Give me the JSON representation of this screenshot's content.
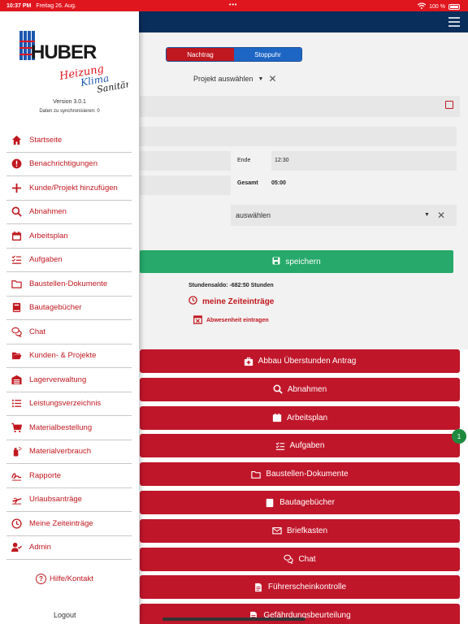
{
  "status": {
    "time": "10:37 PM",
    "date": "Freitag 26. Aug.",
    "battery": "100 %"
  },
  "segment": {
    "left": "Nachtrag",
    "right": "Stoppuhr"
  },
  "project_select": {
    "placeholder": "Projekt auswählen"
  },
  "form": {
    "ende_label": "Ende",
    "ende_value": "12:30",
    "gesamt_label": "Gesamt",
    "gesamt_value": "05:00",
    "select_placeholder": "auswählen",
    "save_label": "speichern",
    "saldo": "Stundensaldo: -682:50 Stunden",
    "zeiteintraege": "meine Zeiteinträge",
    "abwesenheit": "Abwesenheit eintragen"
  },
  "buttons": [
    {
      "label": "Abbau Überstunden Antrag",
      "icon": "first-aid-icon"
    },
    {
      "label": "Abnahmen",
      "icon": "search-icon"
    },
    {
      "label": "Arbeitsplan",
      "icon": "calendar-icon"
    },
    {
      "label": "Aufgaben",
      "icon": "checklist-icon"
    },
    {
      "label": "Baustellen-Dokumente",
      "icon": "folder-icon"
    },
    {
      "label": "Bautagebücher",
      "icon": "book-icon"
    },
    {
      "label": "Briefkasten",
      "icon": "mail-icon"
    },
    {
      "label": "Chat",
      "icon": "chat-icon"
    },
    {
      "label": "Führerscheinkontrolle",
      "icon": "document-icon"
    },
    {
      "label": "Gefährdungsbeurteilung",
      "icon": "document-icon"
    }
  ],
  "badge": "1",
  "drawer": {
    "logo": {
      "main": "HUBER",
      "line1": "Heizung",
      "line2": "Klima",
      "line3": "Sanitär"
    },
    "version": "Version 3.0.1",
    "sync": "Daten zu synchronisieren: 0",
    "items": [
      {
        "label": "Startseite",
        "icon": "home-icon"
      },
      {
        "label": "Benachrichtigungen",
        "icon": "alert-icon"
      },
      {
        "label": "Kunde/Projekt hinzufügen",
        "icon": "plus-icon"
      },
      {
        "label": "Abnahmen",
        "icon": "search-icon"
      },
      {
        "label": "Arbeitsplan",
        "icon": "calendar-icon"
      },
      {
        "label": "Aufgaben",
        "icon": "checklist-icon"
      },
      {
        "label": "Baustellen-Dokumente",
        "icon": "folder-icon"
      },
      {
        "label": "Bautagebücher",
        "icon": "book-icon"
      },
      {
        "label": "Chat",
        "icon": "chat-icon"
      },
      {
        "label": "Kunden- & Projekte",
        "icon": "folder-open-icon"
      },
      {
        "label": "Lagerverwaltung",
        "icon": "warehouse-icon"
      },
      {
        "label": "Leistungsverzeichnis",
        "icon": "list-icon"
      },
      {
        "label": "Materialbestellung",
        "icon": "cart-icon"
      },
      {
        "label": "Materialverbrauch",
        "icon": "spray-icon"
      },
      {
        "label": "Rapporte",
        "icon": "signature-icon"
      },
      {
        "label": "Urlaubsanträge",
        "icon": "plane-icon"
      },
      {
        "label": "Meine Zeiteinträge",
        "icon": "clock-icon"
      },
      {
        "label": "Admin",
        "icon": "user-check-icon"
      }
    ],
    "help": "Hilfe/Kontakt",
    "logout": "Logout"
  }
}
